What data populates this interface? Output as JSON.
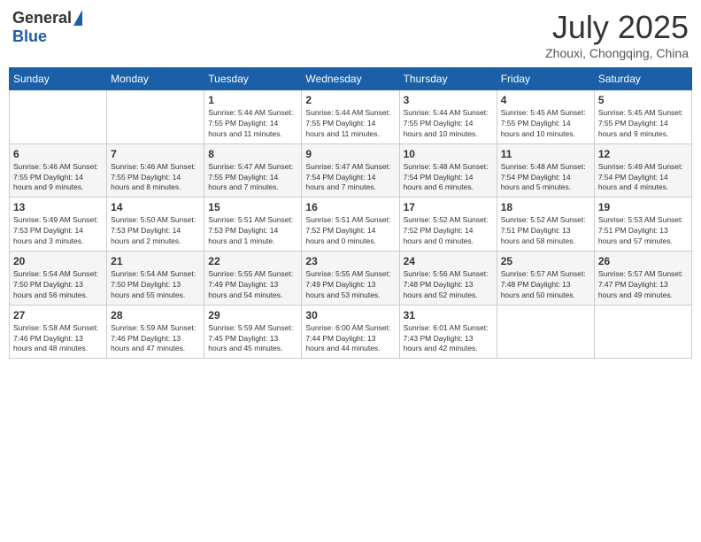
{
  "header": {
    "logo_general": "General",
    "logo_blue": "Blue",
    "month_title": "July 2025",
    "location": "Zhouxi, Chongqing, China"
  },
  "weekdays": [
    "Sunday",
    "Monday",
    "Tuesday",
    "Wednesday",
    "Thursday",
    "Friday",
    "Saturday"
  ],
  "weeks": [
    [
      {
        "day": "",
        "detail": ""
      },
      {
        "day": "",
        "detail": ""
      },
      {
        "day": "1",
        "detail": "Sunrise: 5:44 AM\nSunset: 7:55 PM\nDaylight: 14 hours and 11 minutes."
      },
      {
        "day": "2",
        "detail": "Sunrise: 5:44 AM\nSunset: 7:55 PM\nDaylight: 14 hours and 11 minutes."
      },
      {
        "day": "3",
        "detail": "Sunrise: 5:44 AM\nSunset: 7:55 PM\nDaylight: 14 hours and 10 minutes."
      },
      {
        "day": "4",
        "detail": "Sunrise: 5:45 AM\nSunset: 7:55 PM\nDaylight: 14 hours and 10 minutes."
      },
      {
        "day": "5",
        "detail": "Sunrise: 5:45 AM\nSunset: 7:55 PM\nDaylight: 14 hours and 9 minutes."
      }
    ],
    [
      {
        "day": "6",
        "detail": "Sunrise: 5:46 AM\nSunset: 7:55 PM\nDaylight: 14 hours and 9 minutes."
      },
      {
        "day": "7",
        "detail": "Sunrise: 5:46 AM\nSunset: 7:55 PM\nDaylight: 14 hours and 8 minutes."
      },
      {
        "day": "8",
        "detail": "Sunrise: 5:47 AM\nSunset: 7:55 PM\nDaylight: 14 hours and 7 minutes."
      },
      {
        "day": "9",
        "detail": "Sunrise: 5:47 AM\nSunset: 7:54 PM\nDaylight: 14 hours and 7 minutes."
      },
      {
        "day": "10",
        "detail": "Sunrise: 5:48 AM\nSunset: 7:54 PM\nDaylight: 14 hours and 6 minutes."
      },
      {
        "day": "11",
        "detail": "Sunrise: 5:48 AM\nSunset: 7:54 PM\nDaylight: 14 hours and 5 minutes."
      },
      {
        "day": "12",
        "detail": "Sunrise: 5:49 AM\nSunset: 7:54 PM\nDaylight: 14 hours and 4 minutes."
      }
    ],
    [
      {
        "day": "13",
        "detail": "Sunrise: 5:49 AM\nSunset: 7:53 PM\nDaylight: 14 hours and 3 minutes."
      },
      {
        "day": "14",
        "detail": "Sunrise: 5:50 AM\nSunset: 7:53 PM\nDaylight: 14 hours and 2 minutes."
      },
      {
        "day": "15",
        "detail": "Sunrise: 5:51 AM\nSunset: 7:53 PM\nDaylight: 14 hours and 1 minute."
      },
      {
        "day": "16",
        "detail": "Sunrise: 5:51 AM\nSunset: 7:52 PM\nDaylight: 14 hours and 0 minutes."
      },
      {
        "day": "17",
        "detail": "Sunrise: 5:52 AM\nSunset: 7:52 PM\nDaylight: 14 hours and 0 minutes."
      },
      {
        "day": "18",
        "detail": "Sunrise: 5:52 AM\nSunset: 7:51 PM\nDaylight: 13 hours and 58 minutes."
      },
      {
        "day": "19",
        "detail": "Sunrise: 5:53 AM\nSunset: 7:51 PM\nDaylight: 13 hours and 57 minutes."
      }
    ],
    [
      {
        "day": "20",
        "detail": "Sunrise: 5:54 AM\nSunset: 7:50 PM\nDaylight: 13 hours and 56 minutes."
      },
      {
        "day": "21",
        "detail": "Sunrise: 5:54 AM\nSunset: 7:50 PM\nDaylight: 13 hours and 55 minutes."
      },
      {
        "day": "22",
        "detail": "Sunrise: 5:55 AM\nSunset: 7:49 PM\nDaylight: 13 hours and 54 minutes."
      },
      {
        "day": "23",
        "detail": "Sunrise: 5:55 AM\nSunset: 7:49 PM\nDaylight: 13 hours and 53 minutes."
      },
      {
        "day": "24",
        "detail": "Sunrise: 5:56 AM\nSunset: 7:48 PM\nDaylight: 13 hours and 52 minutes."
      },
      {
        "day": "25",
        "detail": "Sunrise: 5:57 AM\nSunset: 7:48 PM\nDaylight: 13 hours and 50 minutes."
      },
      {
        "day": "26",
        "detail": "Sunrise: 5:57 AM\nSunset: 7:47 PM\nDaylight: 13 hours and 49 minutes."
      }
    ],
    [
      {
        "day": "27",
        "detail": "Sunrise: 5:58 AM\nSunset: 7:46 PM\nDaylight: 13 hours and 48 minutes."
      },
      {
        "day": "28",
        "detail": "Sunrise: 5:59 AM\nSunset: 7:46 PM\nDaylight: 13 hours and 47 minutes."
      },
      {
        "day": "29",
        "detail": "Sunrise: 5:59 AM\nSunset: 7:45 PM\nDaylight: 13 hours and 45 minutes."
      },
      {
        "day": "30",
        "detail": "Sunrise: 6:00 AM\nSunset: 7:44 PM\nDaylight: 13 hours and 44 minutes."
      },
      {
        "day": "31",
        "detail": "Sunrise: 6:01 AM\nSunset: 7:43 PM\nDaylight: 13 hours and 42 minutes."
      },
      {
        "day": "",
        "detail": ""
      },
      {
        "day": "",
        "detail": ""
      }
    ]
  ]
}
